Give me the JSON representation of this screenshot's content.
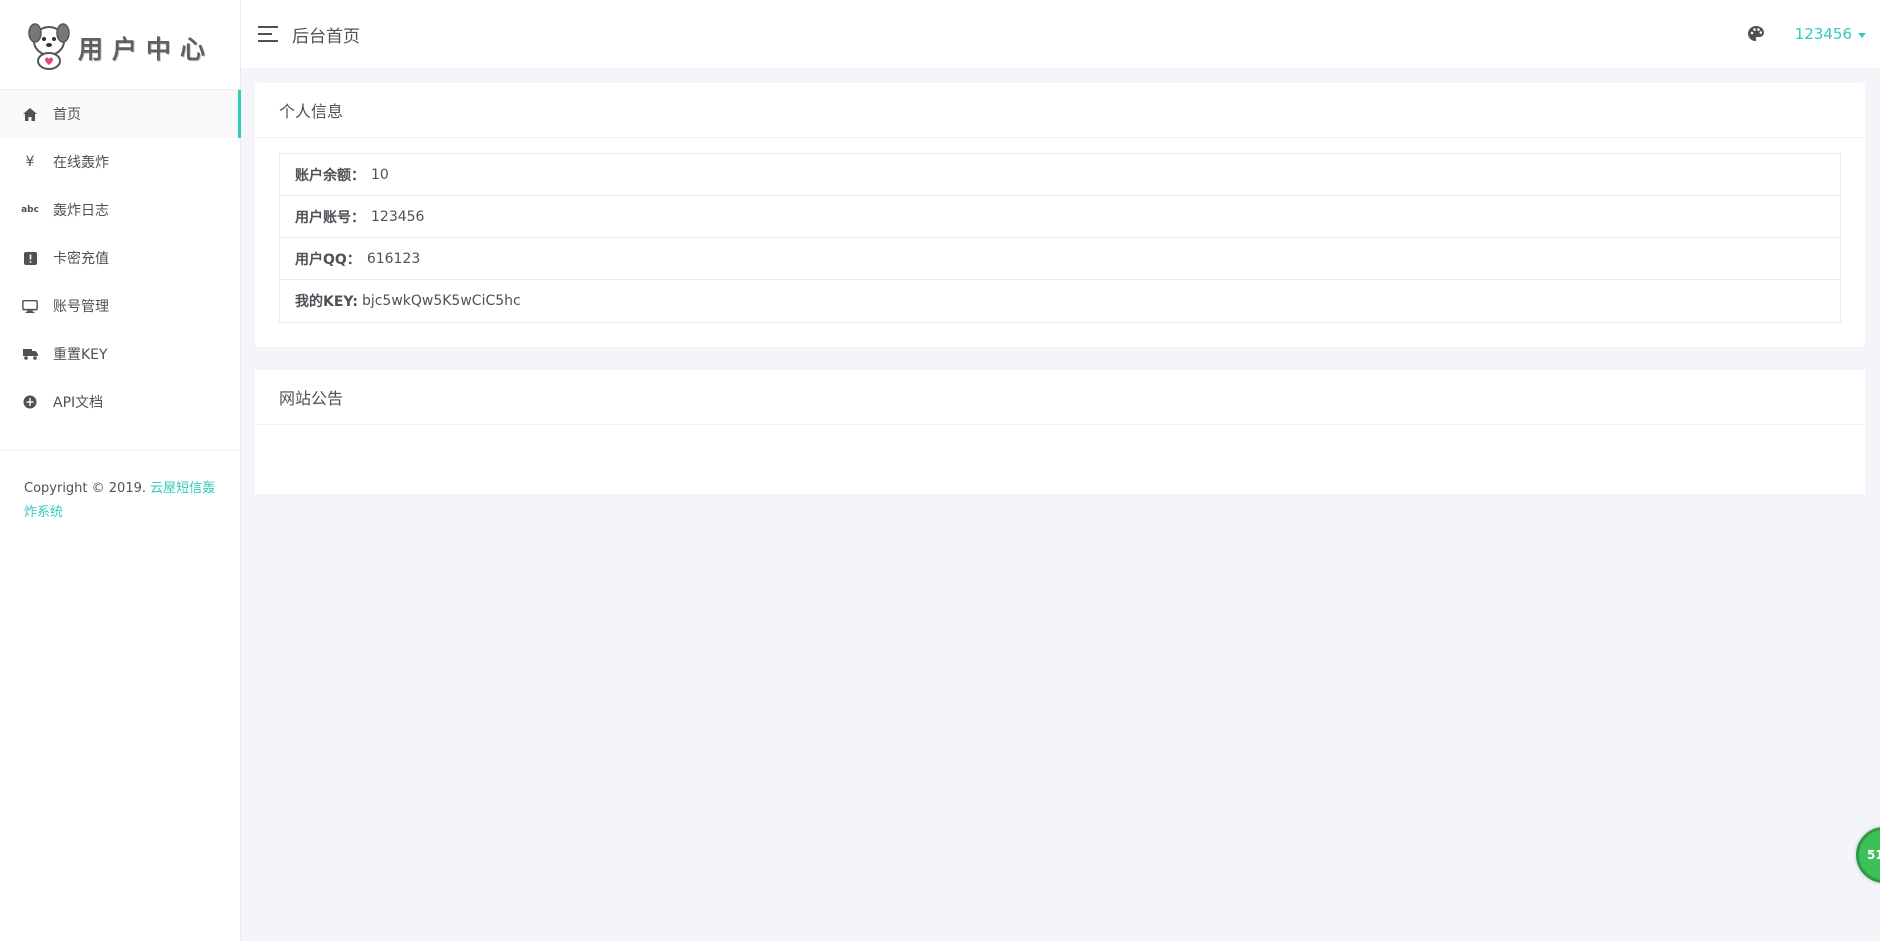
{
  "brand": {
    "logo_text": "用户中心"
  },
  "sidebar": {
    "items": [
      {
        "label": "首页",
        "icon": "home-icon",
        "active": true
      },
      {
        "label": "在线轰炸",
        "icon": "yen-icon",
        "active": false
      },
      {
        "label": "轰炸日志",
        "icon": "abc-icon",
        "active": false
      },
      {
        "label": "卡密充值",
        "icon": "alert-box-icon",
        "active": false
      },
      {
        "label": "账号管理",
        "icon": "monitor-icon",
        "active": false
      },
      {
        "label": "重置KEY",
        "icon": "truck-icon",
        "active": false
      },
      {
        "label": "API文档",
        "icon": "bug-icon",
        "active": false
      }
    ],
    "copyright_text": "Copyright © 2019. ",
    "copyright_link": "云屋短信轰炸系统"
  },
  "topbar": {
    "page_title": "后台首页",
    "username": "123456"
  },
  "profile_card": {
    "title": "个人信息",
    "rows": [
      {
        "label": "账户余额：",
        "value": "10"
      },
      {
        "label": "用户账号：",
        "value": "123456"
      },
      {
        "label": "用户QQ：",
        "value": "616123"
      },
      {
        "label": "我的KEY:",
        "value": "bjc5wkQw5K5wCiC5hc"
      }
    ]
  },
  "notice_card": {
    "title": "网站公告"
  },
  "float_badge": {
    "text": "51"
  },
  "colors": {
    "accent": "#33cabb",
    "background": "#f4f5fa",
    "text": "#4d5259"
  }
}
